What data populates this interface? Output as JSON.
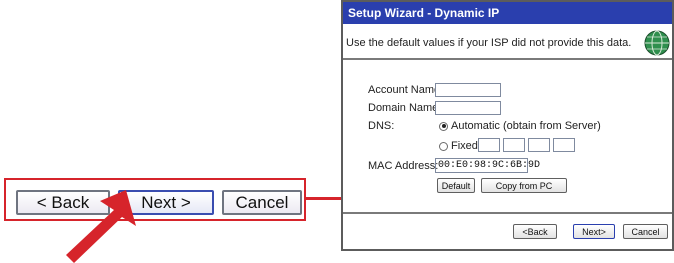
{
  "zoom": {
    "back_label": "< Back",
    "next_label": "Next >",
    "cancel_label": "Cancel"
  },
  "dialog": {
    "title": "Setup Wizard - Dynamic IP",
    "header_text": "Use the default values if your ISP did not provide this data.",
    "account_name_label": "Account Name:",
    "account_name_value": "",
    "domain_name_label": "Domain Name:",
    "domain_name_value": "",
    "dns_label": "DNS:",
    "dns_auto_label": "Automatic (obtain from Server)",
    "dns_fixed_label": "Fixed:",
    "dns_selected": "automatic",
    "mac_label": "MAC Address:",
    "mac_value": "00:E0:98:9C:6B:9D",
    "default_button": "Default",
    "copy_button": "Copy from PC",
    "footer": {
      "back_label": "<Back",
      "next_label": "Next>",
      "cancel_label": "Cancel"
    }
  },
  "colors": {
    "highlight": "#d6242b",
    "titlebar": "#2a3fae"
  },
  "icons": {
    "globe": "globe-icon",
    "pointer": "red-pointer-arrow"
  }
}
